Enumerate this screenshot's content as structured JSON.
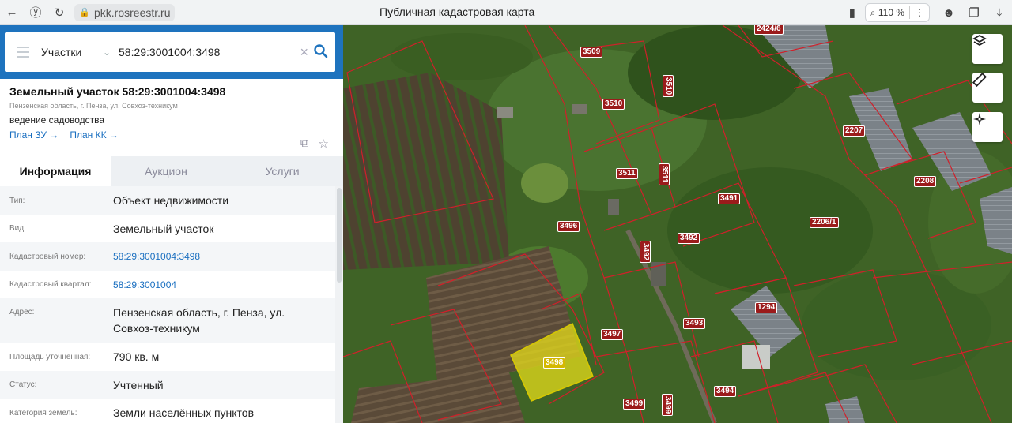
{
  "browser": {
    "url": "pkk.rosreestr.ru",
    "title": "Публичная кадастровая карта",
    "zoom": "110 %"
  },
  "search": {
    "type": "Участки",
    "value": "58:29:3001004:3498"
  },
  "card": {
    "title": "Земельный участок 58:29:3001004:3498",
    "address_small": "Пензенская область, г. Пенза, ул. Совхоз-техникум",
    "purpose": "ведение садоводства",
    "link1": "План ЗУ →",
    "link2": "План КК →"
  },
  "tabs": [
    "Информация",
    "Аукцион",
    "Услуги"
  ],
  "rows": [
    {
      "k": "Тип:",
      "v": "Объект недвижимости"
    },
    {
      "k": "Вид:",
      "v": "Земельный участок"
    },
    {
      "k": "Кадастровый номер:",
      "v": "58:29:3001004:3498"
    },
    {
      "k": "Кадастровый квартал:",
      "v": "58:29:3001004"
    },
    {
      "k": "Адрес:",
      "v": "Пензенская область, г. Пенза, ул. Совхоз-техникум"
    },
    {
      "k": "Площадь уточненная:",
      "v": "790 кв. м"
    },
    {
      "k": "Статус:",
      "v": "Учтенный"
    },
    {
      "k": "Категория земель:",
      "v": "Земли населённых пунктов"
    }
  ],
  "map_labels": {
    "l3509": "3509",
    "l3510": "3510",
    "l3510v": "3510",
    "l3511": "3511",
    "l3511v": "3511",
    "l2207": "2207",
    "l2208": "2208",
    "l3491": "3491",
    "l3496": "3496",
    "l3492": "3492",
    "l3492v": "3492",
    "l2206": "2206/1",
    "l1294": "1294",
    "l3493": "3493",
    "l3497": "3497",
    "l3498": "3498",
    "l3494": "3494",
    "l3499": "3499",
    "l3499v": "3499",
    "l2424": "2424/6"
  },
  "colors": {
    "accent": "#1e73be",
    "boundary": "#d0202a",
    "selected_fill": "#e6dc1a"
  }
}
